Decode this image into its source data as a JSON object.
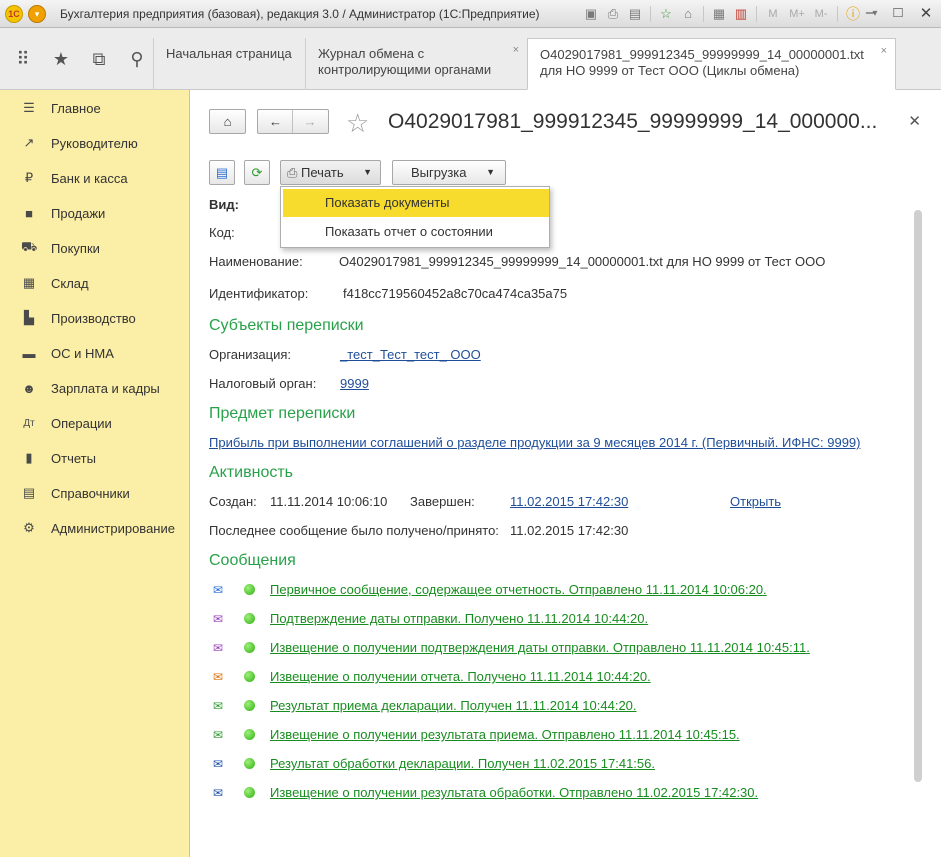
{
  "window": {
    "title": "Бухгалтерия предприятия (базовая), редакция 3.0 / Администратор  (1С:Предприятие)",
    "toolbar_text_buttons": [
      "M",
      "M+",
      "M-"
    ]
  },
  "tabs": [
    {
      "label": "Начальная страница"
    },
    {
      "label": "Журнал обмена с контролирующими органами"
    },
    {
      "label": "О4029017981_999912345_99999999_14_00000001.txt для НО 9999 от Тест ООО (Циклы обмена)"
    }
  ],
  "sidebar": {
    "items": [
      {
        "label": "Главное",
        "icon": "menu-lines-icon"
      },
      {
        "label": "Руководителю",
        "icon": "trend-icon"
      },
      {
        "label": "Банк и касса",
        "icon": "ruble-coin-icon"
      },
      {
        "label": "Продажи",
        "icon": "briefcase-icon"
      },
      {
        "label": "Покупки",
        "icon": "cart-icon"
      },
      {
        "label": "Склад",
        "icon": "warehouse-icon"
      },
      {
        "label": "Производство",
        "icon": "factory-icon"
      },
      {
        "label": "ОС и НМА",
        "icon": "truck-icon"
      },
      {
        "label": "Зарплата и кадры",
        "icon": "people-icon"
      },
      {
        "label": "Операции",
        "icon": "dt-kt-icon"
      },
      {
        "label": "Отчеты",
        "icon": "bar-chart-icon"
      },
      {
        "label": "Справочники",
        "icon": "books-icon"
      },
      {
        "label": "Администрирование",
        "icon": "gear-icon"
      }
    ]
  },
  "doc": {
    "title": "О4029017981_999912345_99999999_14_000000...",
    "print_label": "Печать",
    "export_label": "Выгрузка",
    "dropdown": [
      {
        "label": "Показать документы",
        "selected": true
      },
      {
        "label": "Показать отчет о состоянии",
        "selected": false
      }
    ],
    "fields": {
      "vid_label": "Вид:",
      "kod_label": "Код:",
      "name_label": "Наименование:",
      "name_value": "О4029017981_999912345_99999999_14_00000001.txt для НО 9999 от Тест ООО",
      "id_label": "Идентификатор:",
      "id_value": "f418cc719560452a8c70ca474ca35a75"
    },
    "subjects": {
      "heading": "Субъекты переписки",
      "org_label": "Организация:",
      "org_value": "_тест_Тест_тест_ ООО",
      "tax_label": "Налоговый орган:",
      "tax_value": "9999"
    },
    "subject_matter": {
      "heading": "Предмет переписки",
      "link": "Прибыль при выполнении соглашений о разделе продукции за 9 месяцев 2014 г. (Первичный. ИФНС: 9999)"
    },
    "activity": {
      "heading": "Активность",
      "created_label": "Создан:",
      "created_value": "11.11.2014 10:06:10",
      "finished_label": "Завершен:",
      "finished_value": "11.02.2015 17:42:30",
      "open_link": "Открыть",
      "last_msg_label": "Последнее сообщение было получено/принято:",
      "last_msg_value": "11.02.2015 17:42:30"
    },
    "messages": {
      "heading": "Сообщения",
      "items": [
        {
          "text": "Первичное сообщение, содержащее отчетность. Отправлено 11.11.2014 10:06:20.",
          "icon_color": "#2a6fd6"
        },
        {
          "text": "Подтверждение даты отправки. Получено 11.11.2014 10:44:20.",
          "icon_color": "#9a3fb8"
        },
        {
          "text": "Извещение о получении подтверждения даты отправки. Отправлено 11.11.2014 10:45:11.",
          "icon_color": "#9a3fb8"
        },
        {
          "text": "Извещение о получении отчета. Получено 11.11.2014 10:44:20.",
          "icon_color": "#d9730d"
        },
        {
          "text": "Результат приема декларации. Получен 11.11.2014 10:44:20.",
          "icon_color": "#2e9a2e"
        },
        {
          "text": "Извещение о получении результата приема. Отправлено 11.11.2014 10:45:15.",
          "icon_color": "#2e9a2e"
        },
        {
          "text": "Результат обработки декларации. Получен 11.02.2015 17:41:56.",
          "icon_color": "#1f4fa8"
        },
        {
          "text": "Извещение о получении результата обработки. Отправлено 11.02.2015 17:42:30.",
          "icon_color": "#1f4fa8"
        }
      ]
    }
  }
}
